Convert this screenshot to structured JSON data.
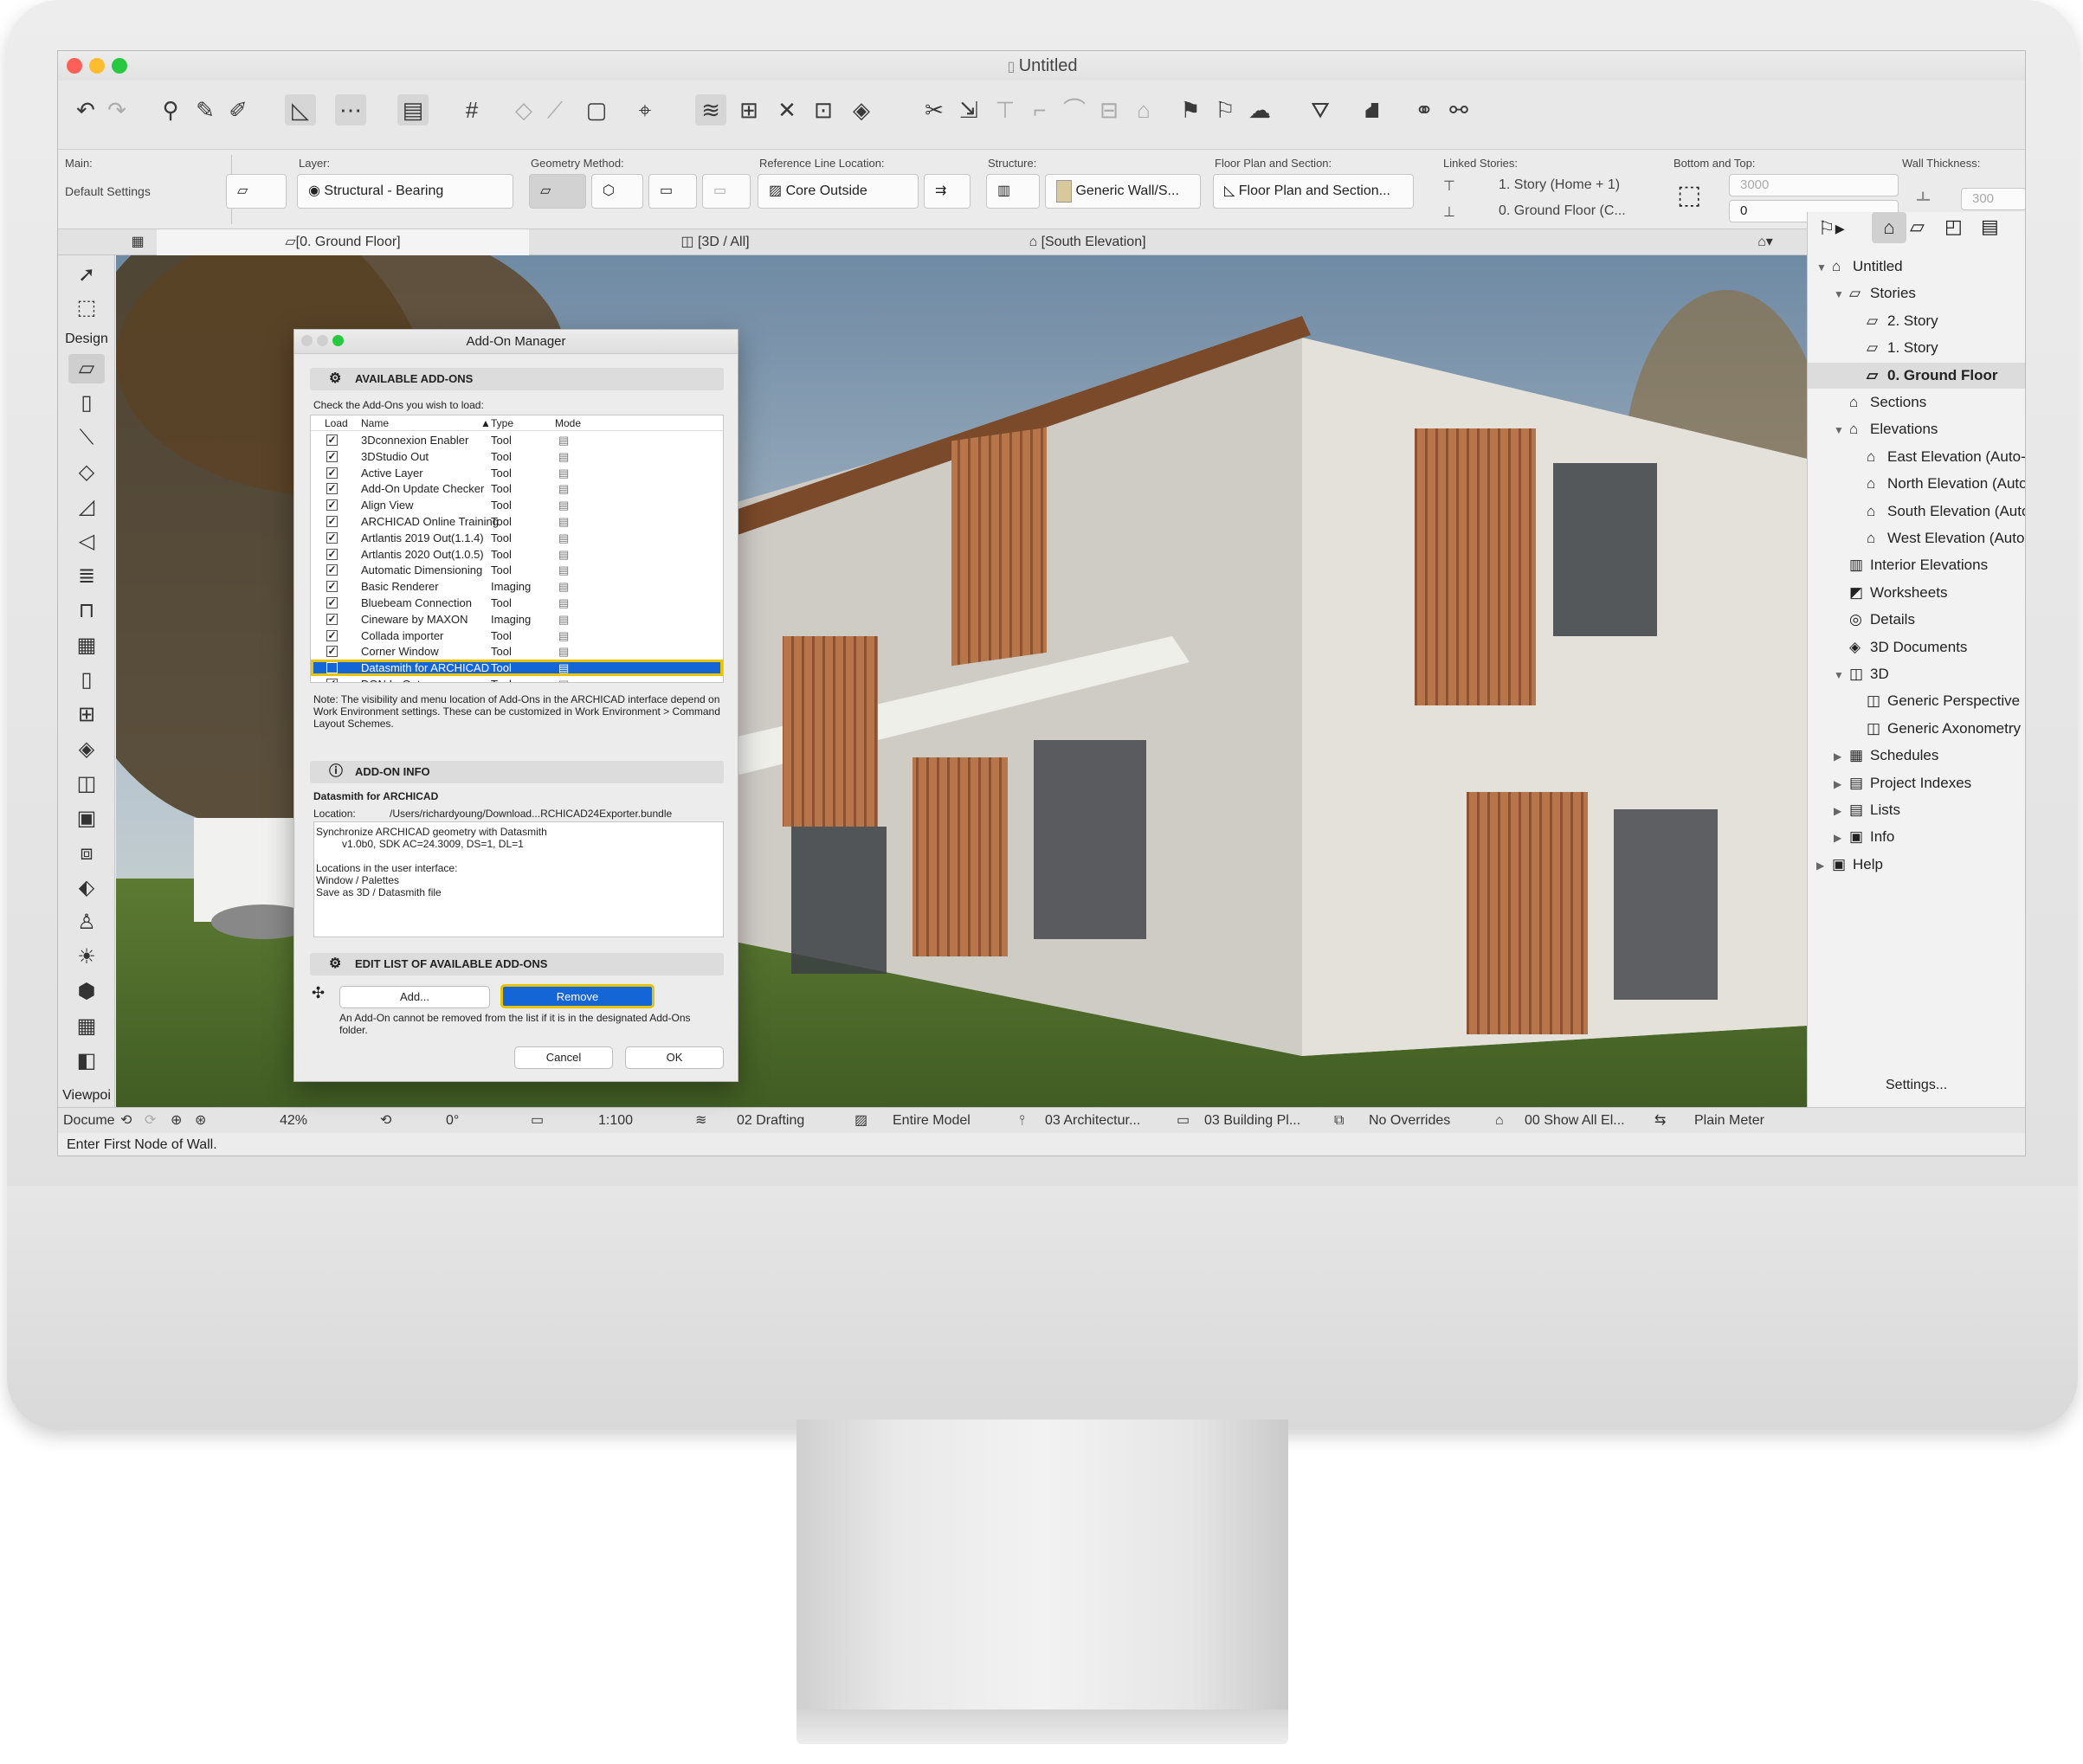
{
  "window": {
    "title": "Untitled"
  },
  "infobox": {
    "main_label": "Main:",
    "main_value": "Default Settings",
    "layer_label": "Layer:",
    "layer_value": "Structural - Bearing",
    "geometry_label": "Geometry Method:",
    "refline_label": "Reference Line Location:",
    "refline_value": "Core Outside",
    "structure_label": "Structure:",
    "structure_value": "Generic Wall/S...",
    "floorplan_label": "Floor Plan and Section:",
    "floorplan_value": "Floor Plan and Section...",
    "linked_label": "Linked Stories:",
    "linked_top": "1. Story (Home + 1)",
    "linked_bottom": "0. Ground Floor (C...",
    "bottomtop_label": "Bottom and Top:",
    "top_value": "3000",
    "bottom_value": "0",
    "thickness_label": "Wall Thickness:",
    "thickness_value": "300"
  },
  "tabs": [
    "[0. Ground Floor]",
    "[3D / All]",
    "[South Elevation]"
  ],
  "toolbox": {
    "design_label": "Design",
    "viewpoint_label": "Viewpoi",
    "document_label": "Docume"
  },
  "navigator": {
    "items": [
      {
        "label": "Untitled",
        "indent": 0,
        "arrow": "▼",
        "icon": "⌂"
      },
      {
        "label": "Stories",
        "indent": 1,
        "arrow": "▼",
        "icon": "▱"
      },
      {
        "label": "2. Story",
        "indent": 2,
        "arrow": "",
        "icon": "▱"
      },
      {
        "label": "1. Story",
        "indent": 2,
        "arrow": "",
        "icon": "▱"
      },
      {
        "label": "0. Ground Floor",
        "indent": 2,
        "arrow": "",
        "icon": "▱",
        "selected": true
      },
      {
        "label": "Sections",
        "indent": 1,
        "arrow": "",
        "icon": "⌂"
      },
      {
        "label": "Elevations",
        "indent": 1,
        "arrow": "▼",
        "icon": "⌂"
      },
      {
        "label": "East Elevation (Auto-",
        "indent": 2,
        "arrow": "",
        "icon": "⌂"
      },
      {
        "label": "North Elevation (Auto",
        "indent": 2,
        "arrow": "",
        "icon": "⌂"
      },
      {
        "label": "South Elevation (Auto",
        "indent": 2,
        "arrow": "",
        "icon": "⌂"
      },
      {
        "label": "West Elevation (Auto",
        "indent": 2,
        "arrow": "",
        "icon": "⌂"
      },
      {
        "label": "Interior Elevations",
        "indent": 1,
        "arrow": "",
        "icon": "▥"
      },
      {
        "label": "Worksheets",
        "indent": 1,
        "arrow": "",
        "icon": "◩"
      },
      {
        "label": "Details",
        "indent": 1,
        "arrow": "",
        "icon": "◎"
      },
      {
        "label": "3D Documents",
        "indent": 1,
        "arrow": "",
        "icon": "◈"
      },
      {
        "label": "3D",
        "indent": 1,
        "arrow": "▼",
        "icon": "◫"
      },
      {
        "label": "Generic Perspective",
        "indent": 2,
        "arrow": "",
        "icon": "◫"
      },
      {
        "label": "Generic Axonometry",
        "indent": 2,
        "arrow": "",
        "icon": "◫"
      },
      {
        "label": "Schedules",
        "indent": 1,
        "arrow": "▶",
        "icon": "▦"
      },
      {
        "label": "Project Indexes",
        "indent": 1,
        "arrow": "▶",
        "icon": "▤"
      },
      {
        "label": "Lists",
        "indent": 1,
        "arrow": "▶",
        "icon": "▤"
      },
      {
        "label": "Info",
        "indent": 1,
        "arrow": "▶",
        "icon": "▣"
      },
      {
        "label": "Help",
        "indent": 0,
        "arrow": "▶",
        "icon": "▣"
      }
    ],
    "settings_label": "Settings..."
  },
  "statusbar": {
    "zoom": "42%",
    "angle": "0°",
    "scale": "1:100",
    "layer_combo": "02 Drafting",
    "model": "Entire Model",
    "pen_set": "03 Architectur...",
    "mvo": "03 Building Pl...",
    "overrides": "No Overrides",
    "renovation": "00 Show All El...",
    "dimension": "Plain Meter"
  },
  "prompt": "Enter First Node of Wall.",
  "dialog": {
    "title": "Add-On Manager",
    "available_header": "AVAILABLE ADD-ONS",
    "instruction": "Check the Add-Ons you wish to load:",
    "columns": {
      "load": "Load",
      "name": "Name",
      "type": "Type",
      "mode": "Mode"
    },
    "rows": [
      {
        "name": "3Dconnexion Enabler",
        "type": "Tool",
        "check": "☑"
      },
      {
        "name": "3DStudio Out",
        "type": "Tool",
        "check": "☑"
      },
      {
        "name": "Active Layer",
        "type": "Tool",
        "check": "☑"
      },
      {
        "name": "Add-On Update Checker",
        "type": "Tool",
        "check": "☑"
      },
      {
        "name": "Align View",
        "type": "Tool",
        "check": "☑"
      },
      {
        "name": "ARCHICAD Online Training",
        "type": "Tool",
        "check": "☑"
      },
      {
        "name": "Artlantis 2019 Out(1.1.4)",
        "type": "Tool",
        "check": "☑"
      },
      {
        "name": "Artlantis 2020 Out(1.0.5)",
        "type": "Tool",
        "check": "☑"
      },
      {
        "name": "Automatic Dimensioning",
        "type": "Tool",
        "check": "☑"
      },
      {
        "name": "Basic Renderer",
        "type": "Imaging",
        "check": "✓"
      },
      {
        "name": "Bluebeam Connection",
        "type": "Tool",
        "check": "☑"
      },
      {
        "name": "Cineware by MAXON",
        "type": "Imaging",
        "check": "✓"
      },
      {
        "name": "Collada importer",
        "type": "Tool",
        "check": "☑"
      },
      {
        "name": "Corner Window",
        "type": "Tool",
        "check": "✓"
      },
      {
        "name": "Datasmith for ARCHICAD",
        "type": "Tool",
        "check": "",
        "selected": true
      },
      {
        "name": "DGN In-Out",
        "type": "Tool",
        "check": "☑"
      }
    ],
    "note": "Note: The visibility and menu location of Add-Ons in the ARCHICAD interface depend on Work Environment settings. These can be customized in Work Environment > Command Layout Schemes.",
    "info_header": "ADD-ON INFO",
    "info_name": "Datasmith for ARCHICAD",
    "location_label": "Location:",
    "location_value": "/Users/richardyoung/Download...RCHICAD24Exporter.bundle",
    "desc1": "Synchronize ARCHICAD geometry with Datasmith",
    "desc2": "v1.0b0, SDK AC=24.3009, DS=1, DL=1",
    "desc3": "Locations in the user interface:",
    "desc4": "Window / Palettes",
    "desc5": "Save as 3D / Datasmith file",
    "edit_header": "EDIT LIST OF AVAILABLE ADD-ONS",
    "add_label": "Add...",
    "remove_label": "Remove",
    "remove_note": "An Add-On cannot be removed from the list if it is in the designated Add-Ons folder.",
    "cancel_label": "Cancel",
    "ok_label": "OK"
  },
  "colors": {
    "accent": "#1466d6",
    "selection_outline": "#e8c300",
    "close": "#fe5f57",
    "minimize": "#febc2e",
    "maximize": "#28c840"
  }
}
